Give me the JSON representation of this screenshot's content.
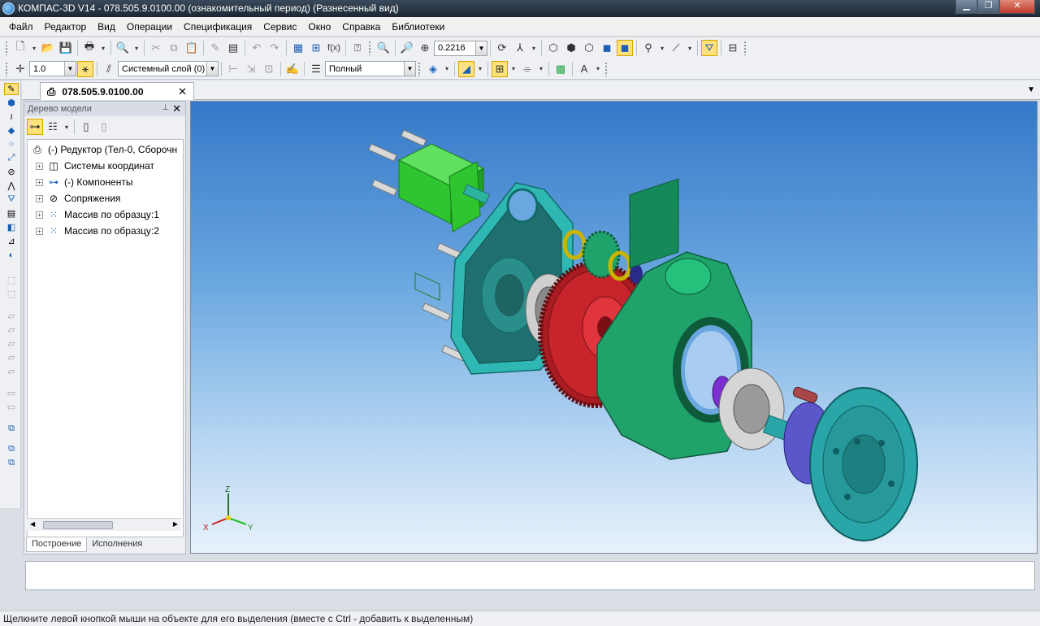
{
  "window": {
    "title": "КОМПАС-3D V14 - 078.505.9.0100.00 (ознакомительный период) (Разнесенный вид)"
  },
  "menu": [
    "Файл",
    "Редактор",
    "Вид",
    "Операции",
    "Спецификация",
    "Сервис",
    "Окно",
    "Справка",
    "Библиотеки"
  ],
  "toolbar": {
    "zoom_value": "0.2216",
    "step_value": "1.0",
    "layer_value": "Системный слой (0)",
    "style_value": "Полный"
  },
  "document": {
    "tab_label": "078.505.9.0100.00",
    "close_glyph": "✕"
  },
  "model_tree": {
    "header": "Дерево модели",
    "items": [
      {
        "label": "(-) Редуктор (Тел-0, Сборочн",
        "icon": "assembly-icon"
      },
      {
        "label": "Системы координат",
        "icon": "coordinate-systems-icon"
      },
      {
        "label": "(-) Компоненты",
        "icon": "components-icon"
      },
      {
        "label": "Сопряжения",
        "icon": "mates-icon"
      },
      {
        "label": "Массив по образцу:1",
        "icon": "pattern-icon"
      },
      {
        "label": "Массив по образцу:2",
        "icon": "pattern-icon"
      }
    ],
    "tabs": [
      "Построение",
      "Исполнения"
    ]
  },
  "axes": {
    "x": "X",
    "y": "Y",
    "z": "Z"
  },
  "status_bar": {
    "text": "Щелкните левой кнопкой мыши на объекте для его выделения (вместе с Ctrl - добавить к выделенным)"
  },
  "colors": {
    "viewport_top": "#3479c8",
    "viewport_bottom": "#e7f1fb",
    "housing": "#1fa36a",
    "cover": "#2fb7b3",
    "gear": "#c8242b",
    "motor": "#2ec52e",
    "flange": "#2aa6a8"
  }
}
